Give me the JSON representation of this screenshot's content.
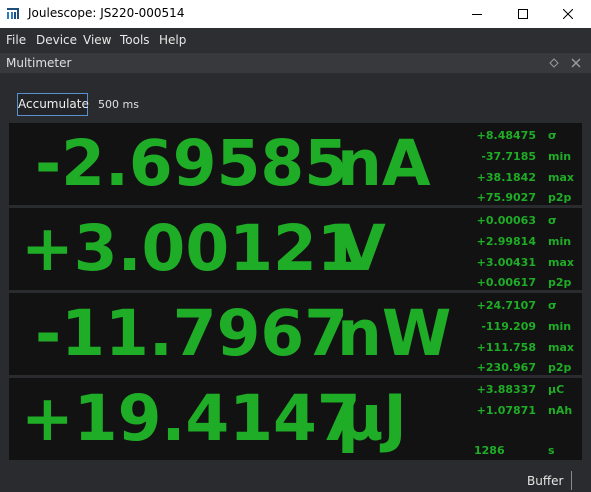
{
  "window": {
    "title": "Joulescope: JS220-000514",
    "icon": "joulescope-logo-icon",
    "controls": [
      "minimize-icon",
      "maximize-icon",
      "close-icon"
    ]
  },
  "menu": [
    "File",
    "Device",
    "View",
    "Tools",
    "Help"
  ],
  "dock": {
    "title": "Multimeter"
  },
  "controls": {
    "accumulate_label": "Accumulate",
    "interval_label": "500 ms",
    "accent_color": "#5a8fd0"
  },
  "colors": {
    "value_green": "#1fac26",
    "panel_background": "#121212"
  },
  "readings": [
    {
      "id": "current",
      "value": "-2.69585",
      "unit": "nA",
      "stats": [
        {
          "value": "+8.48475",
          "label": "σ"
        },
        {
          "value": "-37.7185",
          "label": "min"
        },
        {
          "value": "+38.1842",
          "label": "max"
        },
        {
          "value": "+75.9027",
          "label": "p2p"
        }
      ]
    },
    {
      "id": "voltage",
      "value": "+3.00121",
      "unit": "V",
      "stats": [
        {
          "value": "+0.00063",
          "label": "σ"
        },
        {
          "value": "+2.99814",
          "label": "min"
        },
        {
          "value": "+3.00431",
          "label": "max"
        },
        {
          "value": "+0.00617",
          "label": "p2p"
        }
      ]
    },
    {
      "id": "power",
      "value": "-11.7967",
      "unit": "nW",
      "stats": [
        {
          "value": "+24.7107",
          "label": "σ"
        },
        {
          "value": "-119.209",
          "label": "min"
        },
        {
          "value": "+111.758",
          "label": "max"
        },
        {
          "value": "+230.967",
          "label": "p2p"
        }
      ]
    },
    {
      "id": "energy",
      "value": "+19.4147",
      "unit": "µJ",
      "stats": [
        {
          "value": "+3.88337",
          "label": "µC"
        },
        {
          "value": "+1.07871",
          "label": "nAh"
        },
        {
          "value": "1286",
          "label": "s"
        }
      ]
    }
  ],
  "status_bar": {
    "buffer_label": "Buffer"
  }
}
